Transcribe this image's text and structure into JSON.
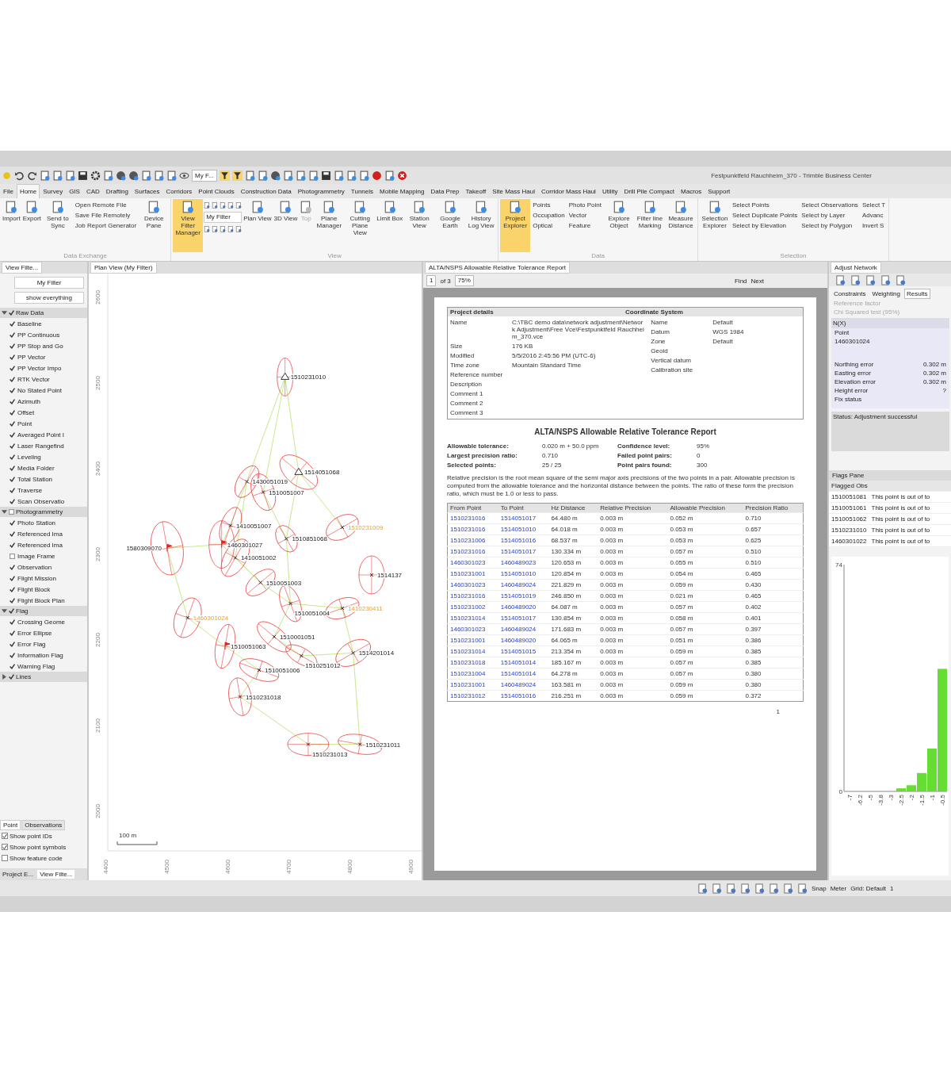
{
  "window": {
    "title": "Festpunktfeld Rauchheim_370 - Trimble Business Center"
  },
  "quick_access": {
    "filter": "My F...",
    "toggles": [
      {
        "on": true
      },
      {
        "on": true
      }
    ]
  },
  "menu_tabs": [
    {
      "label": "File",
      "selected": false
    },
    {
      "label": "Home",
      "selected": true
    },
    {
      "label": "Survey",
      "selected": false
    },
    {
      "label": "GIS",
      "selected": false
    },
    {
      "label": "CAD",
      "selected": false
    },
    {
      "label": "Drafting",
      "selected": false
    },
    {
      "label": "Surfaces",
      "selected": false
    },
    {
      "label": "Corridors",
      "selected": false
    },
    {
      "label": "Point Clouds",
      "selected": false
    },
    {
      "label": "Construction Data",
      "selected": false
    },
    {
      "label": "Photogrammetry",
      "selected": false
    },
    {
      "label": "Tunnels",
      "selected": false
    },
    {
      "label": "Mobile Mapping",
      "selected": false
    },
    {
      "label": "Data Prep",
      "selected": false
    },
    {
      "label": "Takeoff",
      "selected": false
    },
    {
      "label": "Site Mass Haul",
      "selected": false
    },
    {
      "label": "Corridor Mass Haul",
      "selected": false
    },
    {
      "label": "Utility",
      "selected": false
    },
    {
      "label": "Drill Pile Compact",
      "selected": false
    },
    {
      "label": "Macros",
      "selected": false
    },
    {
      "label": "Support",
      "selected": false
    }
  ],
  "ribbon": [
    {
      "group": "Data Exchange",
      "items": [
        {
          "kind": "large",
          "label": "Import",
          "on": false,
          "disabled": false
        },
        {
          "kind": "large",
          "label": "Export",
          "on": false,
          "disabled": false
        },
        {
          "kind": "large",
          "label": "Send to Sync",
          "on": false,
          "disabled": false
        },
        {
          "kind": "list",
          "entries": [
            "Open Remote File",
            "Save File Remotely",
            "Job Report Generator"
          ]
        },
        {
          "kind": "large",
          "label": "Device Pane",
          "on": false,
          "disabled": false
        }
      ]
    },
    {
      "group": "View",
      "items": [
        {
          "kind": "large",
          "label": "View Filter Manager",
          "on": true,
          "disabled": false
        },
        {
          "kind": "filter",
          "value": "My Filter"
        },
        {
          "kind": "large",
          "label": "Plan View",
          "on": false,
          "disabled": false
        },
        {
          "kind": "large",
          "label": "3D View",
          "on": false,
          "disabled": false
        },
        {
          "kind": "large",
          "label": "Top",
          "on": false,
          "disabled": true
        },
        {
          "kind": "large",
          "label": "Plane Manager",
          "on": false,
          "disabled": false
        },
        {
          "kind": "large",
          "label": "Cutting Plane View",
          "on": false,
          "disabled": false
        },
        {
          "kind": "large",
          "label": "Limit Box",
          "on": false,
          "disabled": false
        },
        {
          "kind": "large",
          "label": "Station View",
          "on": false,
          "disabled": false
        },
        {
          "kind": "large",
          "label": "Google Earth",
          "on": false,
          "disabled": false
        },
        {
          "kind": "large",
          "label": "History Log View",
          "on": false,
          "disabled": false
        }
      ]
    },
    {
      "group": "Data",
      "items": [
        {
          "kind": "large",
          "label": "Project Explorer",
          "on": true,
          "disabled": false
        },
        {
          "kind": "list",
          "entries": [
            "Points",
            "Occupation",
            "Optical"
          ]
        },
        {
          "kind": "list",
          "entries": [
            "Photo Point",
            "Vector",
            "Feature"
          ]
        },
        {
          "kind": "large",
          "label": "Explore Object",
          "on": false,
          "disabled": false
        },
        {
          "kind": "large",
          "label": "Filter line Marking",
          "on": false,
          "disabled": false
        },
        {
          "kind": "large",
          "label": "Measure Distance",
          "on": false,
          "disabled": false
        }
      ]
    },
    {
      "group": "Selection",
      "items": [
        {
          "kind": "large",
          "label": "Selection Explorer",
          "on": false,
          "disabled": false
        },
        {
          "kind": "list",
          "entries": [
            "Select Points",
            "Select Duplicate Points",
            "Select by Elevation"
          ]
        },
        {
          "kind": "list",
          "entries": [
            "Select Observations",
            "Select by Layer",
            "Select by Polygon"
          ]
        },
        {
          "kind": "list",
          "entries": [
            "Select T",
            "Advanc",
            "Invert S"
          ]
        }
      ]
    }
  ],
  "left_panel": {
    "tab": "View Filte...",
    "filter": "My Filter",
    "preset": "show everything",
    "groups": [
      {
        "label": "Raw Data",
        "checked": true,
        "expanded": true,
        "children": [
          {
            "label": "Baseline",
            "checked": true
          },
          {
            "label": "PP Continuous",
            "checked": true
          },
          {
            "label": "PP Stop and Go",
            "checked": true
          },
          {
            "label": "PP Vector",
            "checked": true
          },
          {
            "label": "PP Vector Impo",
            "checked": true
          },
          {
            "label": "RTK Vector",
            "checked": true
          },
          {
            "label": "No Stated Point",
            "checked": true
          },
          {
            "label": "Azimuth",
            "checked": true
          },
          {
            "label": "Offset",
            "checked": true
          },
          {
            "label": "Point",
            "checked": true
          },
          {
            "label": "Averaged Point I",
            "checked": true
          },
          {
            "label": "Laser Rangefind",
            "checked": true
          },
          {
            "label": "Leveling",
            "checked": true
          },
          {
            "label": "Media Folder",
            "checked": true
          },
          {
            "label": "Total Station",
            "checked": true
          },
          {
            "label": "Traverse",
            "checked": true
          },
          {
            "label": "Scan Observatio",
            "checked": true
          }
        ]
      },
      {
        "label": "Photogrammetry",
        "checked": false,
        "expanded": true,
        "children": [
          {
            "label": "Photo Station",
            "checked": true
          },
          {
            "label": "Referenced Ima",
            "checked": true
          },
          {
            "label": "Referenced Ima",
            "checked": true
          },
          {
            "label": "Image Frame",
            "checked": false
          },
          {
            "label": "Observation",
            "checked": true
          },
          {
            "label": "Flight Mission",
            "checked": true
          },
          {
            "label": "Flight Block",
            "checked": true
          },
          {
            "label": "Flight Block Plan",
            "checked": true
          }
        ]
      },
      {
        "label": "Flag",
        "checked": true,
        "expanded": true,
        "children": [
          {
            "label": "Crossing Geome",
            "checked": true
          },
          {
            "label": "Error Ellipse",
            "checked": true
          },
          {
            "label": "Error Flag",
            "checked": true
          },
          {
            "label": "Information Flag",
            "checked": true
          },
          {
            "label": "Warning Flag",
            "checked": true
          }
        ]
      },
      {
        "label": "Lines",
        "checked": true,
        "expanded": false
      }
    ],
    "option_tabs": [
      {
        "label": "Point",
        "selected": true
      },
      {
        "label": "Observations",
        "selected": false
      }
    ],
    "options": [
      {
        "label": "Show point IDs",
        "checked": true
      },
      {
        "label": "Show point symbols",
        "checked": true
      },
      {
        "label": "Show feature code",
        "checked": false
      }
    ],
    "bottom_tabs": [
      {
        "label": "Project E...",
        "selected": false
      },
      {
        "label": "View Filte...",
        "selected": true
      }
    ]
  },
  "map": {
    "tab": "Plan View (My Filter)",
    "yticks": [
      "2600",
      "2500",
      "2400",
      "2300",
      "2200",
      "2100",
      "2000"
    ],
    "xticks": [
      "4400",
      "4500",
      "4600",
      "4700",
      "4800",
      "4900"
    ],
    "scale": "100 m",
    "points": [
      {
        "label": "1510231010",
        "kind": "control",
        "flagged": false
      },
      {
        "label": "1514051068",
        "kind": "control",
        "flagged": false
      },
      {
        "label": "1430051019",
        "kind": "point",
        "flagged": false
      },
      {
        "label": "1510051007",
        "kind": "point",
        "flagged": false
      },
      {
        "label": "1410051007",
        "kind": "point",
        "flagged": false
      },
      {
        "label": "1510231009",
        "kind": "point",
        "flagged": true
      },
      {
        "label": "1510851068",
        "kind": "point",
        "flagged": false
      },
      {
        "label": "1460301027",
        "kind": "flag",
        "flagged": false
      },
      {
        "label": "1580309070",
        "kind": "flag",
        "flagged": false
      },
      {
        "label": "1410051002",
        "kind": "point",
        "flagged": false
      },
      {
        "label": "1514137",
        "kind": "point",
        "flagged": false
      },
      {
        "label": "1510051003",
        "kind": "point",
        "flagged": false
      },
      {
        "label": "1510051004",
        "kind": "point",
        "flagged": false
      },
      {
        "label": "1410230411",
        "kind": "point",
        "flagged": true
      },
      {
        "label": "1460301024",
        "kind": "point",
        "flagged": true
      },
      {
        "label": "1510001051",
        "kind": "point",
        "flagged": false
      },
      {
        "label": "1510051063",
        "kind": "flag",
        "flagged": false
      },
      {
        "label": "1514201014",
        "kind": "point",
        "flagged": false
      },
      {
        "label": "1510251012",
        "kind": "point",
        "flagged": false
      },
      {
        "label": "1510051006",
        "kind": "point",
        "flagged": false
      },
      {
        "label": "1510231018",
        "kind": "point",
        "flagged": false
      },
      {
        "label": "1510231013",
        "kind": "point",
        "flagged": false
      },
      {
        "label": "1510231011",
        "kind": "point",
        "flagged": false
      }
    ]
  },
  "report": {
    "tab": "ALTA/NSPS Allowable Relative Tolerance Report",
    "page": "1",
    "page_count": "of 3",
    "zoom": "75%",
    "find": "Find",
    "next": "Next",
    "project_details": {
      "heading": "Project details",
      "rows": [
        {
          "label": "Name",
          "value": "C:\\TBC demo data\\network adjustment\\Network Adjustment\\Free Vce\\Festpunktfeld Rauchheim_370.vce"
        },
        {
          "label": "Size",
          "value": "176 KB"
        },
        {
          "label": "Modified",
          "value": "5/5/2016 2:45:56 PM (UTC-6)"
        },
        {
          "label": "Time zone",
          "value": "Mountain Standard Time"
        },
        {
          "label": "Reference number",
          "value": ""
        },
        {
          "label": "Description",
          "value": ""
        },
        {
          "label": "Comment 1",
          "value": ""
        },
        {
          "label": "Comment 2",
          "value": ""
        },
        {
          "label": "Comment 3",
          "value": ""
        }
      ]
    },
    "coordinate_system": {
      "heading": "Coordinate System",
      "rows": [
        {
          "label": "Name",
          "value": "Default"
        },
        {
          "label": "Datum",
          "value": "WGS 1984"
        },
        {
          "label": "Zone",
          "value": "Default"
        },
        {
          "label": "Geoid",
          "value": ""
        },
        {
          "label": "Vertical datum",
          "value": ""
        },
        {
          "label": "Calibration site",
          "value": ""
        }
      ]
    },
    "title": "ALTA/NSPS Allowable Relative Tolerance Report",
    "summary": [
      {
        "label": "Allowable tolerance:",
        "value": "0.020 m + 50.0 ppm"
      },
      {
        "label": "Confidence level:",
        "value": "95%"
      },
      {
        "label": "Largest precision ratio:",
        "value": "0.710"
      },
      {
        "label": "Failed point pairs:",
        "value": "0"
      },
      {
        "label": "Selected points:",
        "value": "25 / 25"
      },
      {
        "label": "Point pairs found:",
        "value": "300"
      }
    ],
    "note": "Relative precision is the root mean square of the semi major axis precisions of the two points in a pair. Allowable precision is computed from the allowable tolerance and the horizontal distance between the points. The ratio of these form the precision ratio, which must be 1.0 or less to pass.",
    "table": {
      "columns": [
        "From Point",
        "To Point",
        "Hz Distance",
        "Relative Precision",
        "Allowable Precision",
        "Precision Ratio"
      ],
      "rows": [
        [
          "1510231016",
          "1514051017",
          "64.480 m",
          "0.003 m",
          "0.052 m",
          "0.710"
        ],
        [
          "1510231016",
          "1514051010",
          "64.018 m",
          "0.003 m",
          "0.053 m",
          "0.657"
        ],
        [
          "1510231006",
          "1514051016",
          "68.537 m",
          "0.003 m",
          "0.053 m",
          "0.625"
        ],
        [
          "1510231016",
          "1514051017",
          "130.334 m",
          "0.003 m",
          "0.057 m",
          "0.510"
        ],
        [
          "1460301023",
          "1460489023",
          "120.653 m",
          "0.003 m",
          "0.055 m",
          "0.510"
        ],
        [
          "1510231001",
          "1514051010",
          "120.854 m",
          "0.003 m",
          "0.054 m",
          "0.465"
        ],
        [
          "1460301023",
          "1460489024",
          "221.829 m",
          "0.003 m",
          "0.059 m",
          "0.430"
        ],
        [
          "1510231016",
          "1514051019",
          "246.850 m",
          "0.003 m",
          "0.021 m",
          "0.465"
        ],
        [
          "1510231002",
          "1460489020",
          "64.087 m",
          "0.003 m",
          "0.057 m",
          "0.402"
        ],
        [
          "1510231014",
          "1514051017",
          "130.854 m",
          "0.003 m",
          "0.058 m",
          "0.401"
        ],
        [
          "1460301023",
          "1460489024",
          "171.683 m",
          "0.003 m",
          "0.057 m",
          "0.397"
        ],
        [
          "1510231001",
          "1460489020",
          "64.065 m",
          "0.003 m",
          "0.051 m",
          "0.386"
        ],
        [
          "1510231014",
          "1514051015",
          "213.354 m",
          "0.003 m",
          "0.059 m",
          "0.385"
        ],
        [
          "1510231018",
          "1514051014",
          "185.167 m",
          "0.003 m",
          "0.057 m",
          "0.385"
        ],
        [
          "1510231004",
          "1514051014",
          "64.278 m",
          "0.003 m",
          "0.057 m",
          "0.380"
        ],
        [
          "1510231001",
          "1460489024",
          "163.581 m",
          "0.003 m",
          "0.059 m",
          "0.380"
        ],
        [
          "1510231012",
          "1514051016",
          "216.251 m",
          "0.003 m",
          "0.059 m",
          "0.372"
        ]
      ]
    },
    "page_number": "1"
  },
  "adjust_network": {
    "title": "Adjust Network",
    "tabs": [
      {
        "label": "Constraints",
        "selected": false
      },
      {
        "label": "Weighting",
        "selected": false
      },
      {
        "label": "Results",
        "selected": true
      }
    ],
    "settings": [
      "Reference factor",
      "Chi Squared test (95%)"
    ],
    "section": "N(X)",
    "tree_group": "Point",
    "tree_item": "1460301024",
    "stats": [
      {
        "label": "Northing error",
        "value": "0.302 m"
      },
      {
        "label": "Easting error",
        "value": "0.302 m"
      },
      {
        "label": "Elevation error",
        "value": "0.302 m"
      },
      {
        "label": "Height error",
        "value": "?"
      },
      {
        "label": "Fix status"
      }
    ],
    "status": "Status: Adjustment successful"
  },
  "flags": {
    "title": "Flags Pane",
    "header": "Flagged Obs",
    "rows": [
      {
        "point": "1510051081",
        "message": "This point is out of to"
      },
      {
        "point": "1510051061",
        "message": "This point is out of to"
      },
      {
        "point": "1510051062",
        "message": "This point is out of to"
      },
      {
        "point": "1510231010",
        "message": "This point is out of to"
      },
      {
        "point": "1460301022",
        "message": "This point is out of to"
      }
    ]
  },
  "histogram": {
    "chart_data": {
      "type": "bar",
      "categories": [
        "-7",
        "-6.2",
        "-5",
        "-3.8",
        "-3",
        "-2.5",
        "-2",
        "-1.5",
        "-1",
        "-0.5"
      ],
      "values": [
        0,
        0,
        0,
        0,
        0,
        1,
        2,
        6,
        14,
        40
      ],
      "ylim": [
        0,
        74
      ],
      "yticks": [
        0,
        74
      ]
    }
  },
  "status_bar": {
    "snap": "Snap",
    "units": "Meter",
    "grid": "Grid: Default",
    "count": "1"
  }
}
